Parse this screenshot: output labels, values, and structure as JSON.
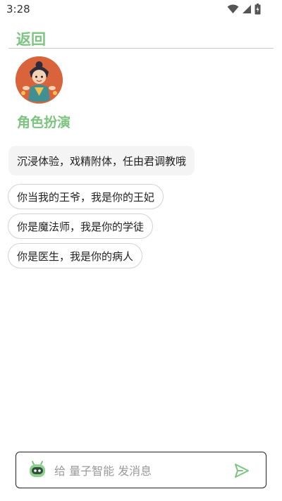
{
  "status_bar": {
    "time": "3:28",
    "icons": [
      "wifi-icon",
      "signal-icon",
      "battery-icon"
    ]
  },
  "header": {
    "back_label": "返回"
  },
  "avatar": {
    "icon": "character-avatar"
  },
  "section": {
    "title": "角色扮演"
  },
  "intro": {
    "text": "沉浸体验，戏精附体，任由君调教哦"
  },
  "suggestions": [
    {
      "label": "你当我的王爷，我是你的王妃"
    },
    {
      "label": "你是魔法师，我是你的学徒"
    },
    {
      "label": "你是医生，我是你的病人"
    }
  ],
  "composer": {
    "placeholder": "给 量子智能 发消息",
    "value": "",
    "send_icon": "send-icon",
    "bot_icon": "robot-icon"
  },
  "colors": {
    "accent": "#7cc47f",
    "bubble_bg": "#f4f4f4",
    "chip_border": "#d2d2d2",
    "avatar_bg": "#d9643b"
  }
}
